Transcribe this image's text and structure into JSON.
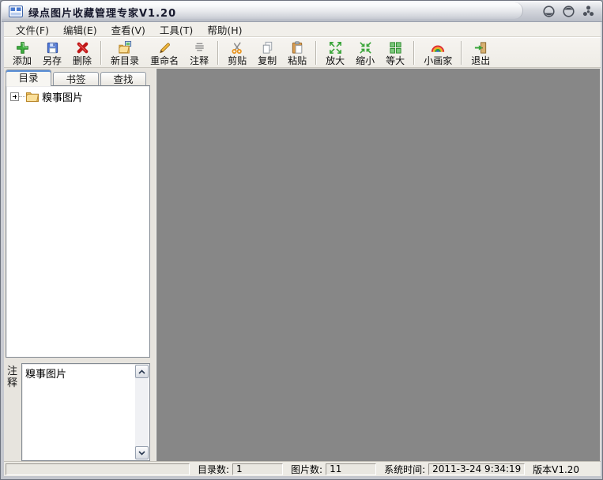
{
  "window": {
    "title": "绿点图片收藏管理专家V1.20",
    "controls": {
      "minimize": "minimize",
      "maximize": "maximize",
      "close": "close"
    }
  },
  "menu": {
    "items": [
      "文件(F)",
      "编辑(E)",
      "查看(V)",
      "工具(T)",
      "帮助(H)"
    ]
  },
  "toolbar": {
    "buttons": [
      {
        "label": "添加",
        "icon": "add-plus-icon"
      },
      {
        "label": "另存",
        "icon": "save-as-floppy-icon"
      },
      {
        "label": "删除",
        "icon": "delete-cross-icon"
      },
      {
        "label": "新目录",
        "icon": "new-folder-icon"
      },
      {
        "label": "重命名",
        "icon": "rename-pencil-icon"
      },
      {
        "label": "注释",
        "icon": "note-lines-icon"
      },
      {
        "label": "剪贴",
        "icon": "cut-scissors-icon"
      },
      {
        "label": "复制",
        "icon": "copy-pages-icon"
      },
      {
        "label": "粘贴",
        "icon": "paste-clipboard-icon"
      },
      {
        "label": "放大",
        "icon": "zoom-in-arrows-icon"
      },
      {
        "label": "缩小",
        "icon": "zoom-out-arrows-icon"
      },
      {
        "label": "等大",
        "icon": "actual-size-icon"
      },
      {
        "label": "小画家",
        "icon": "painter-rainbow-icon"
      },
      {
        "label": "退出",
        "icon": "exit-door-icon"
      }
    ]
  },
  "sidebar": {
    "tabs": [
      {
        "label": "目录",
        "active": true
      },
      {
        "label": "书签",
        "active": false
      },
      {
        "label": "查找",
        "active": false
      }
    ],
    "tree": {
      "root_label": "糗事图片"
    },
    "notes": {
      "label": "注释",
      "text": "糗事图片"
    }
  },
  "statusbar": {
    "fields": [
      {
        "label": "目录数:",
        "value": "1"
      },
      {
        "label": "图片数:",
        "value": "11"
      },
      {
        "label": "系统时间:",
        "value": "2011-3-24 9:34:19"
      }
    ],
    "version": "版本V1.20"
  },
  "colors": {
    "canvas": "#878787",
    "tab_accent": "#5b8fd6",
    "toolbar_bg": "#f2f0eb"
  }
}
